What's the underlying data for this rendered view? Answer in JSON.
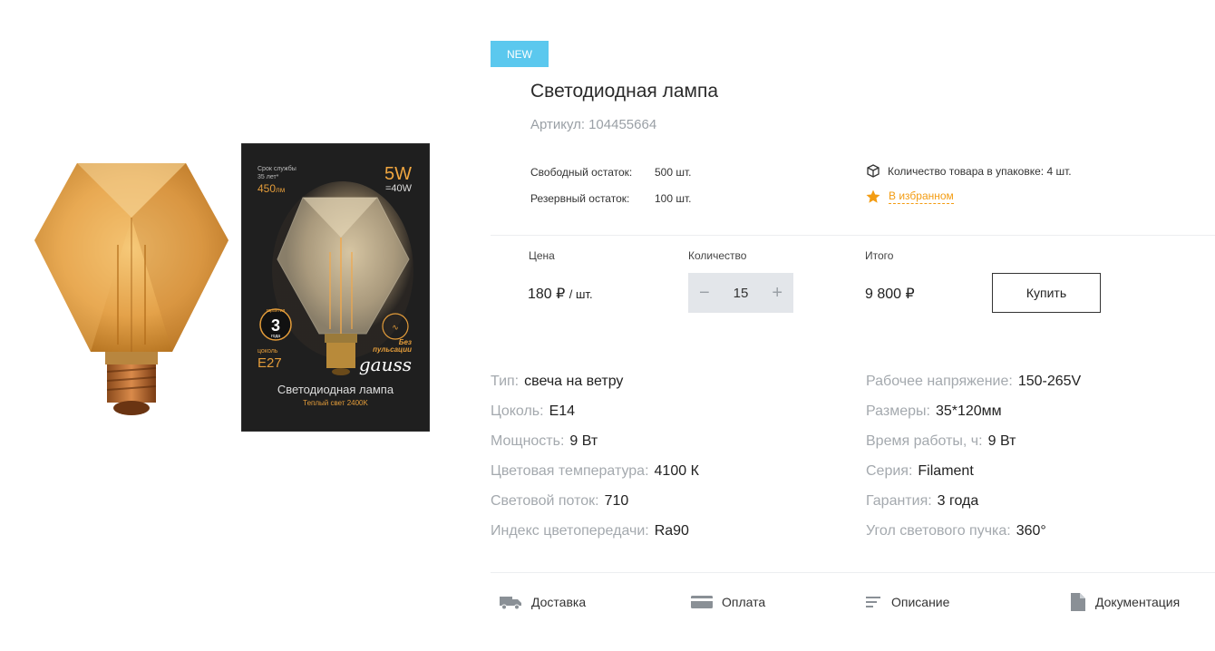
{
  "product": {
    "badge": "NEW",
    "title": "Светодиодная лампа",
    "sku_label": "Артикул:",
    "sku": "104455664",
    "box_print": {
      "lifetime_label": "Срок службы",
      "lifetime_value": "35 лет*",
      "lumen": "450",
      "lumen_unit": "лм",
      "watt": "5W",
      "watt_eq": "=40W",
      "warranty_word": "гарантия",
      "warranty_years": "3",
      "warranty_years_word": "года",
      "base_label": "цоколь",
      "base": "E27",
      "no_flicker_1": "Без",
      "no_flicker_2": "пульсации",
      "brand": "gauss",
      "name": "Светодиодная лампа",
      "light": "Теплый свет 2400K"
    }
  },
  "stock": {
    "free_label": "Свободный остаток:",
    "free_value": "500 шт.",
    "reserve_label": "Резервный остаток:",
    "reserve_value": "100 шт.",
    "pack_text": "Количество товара в упаковке: 4 шт.",
    "pack_icon": "box-icon",
    "favorite_text": "В избранном",
    "favorite_icon": "star-icon"
  },
  "order": {
    "price_caption": "Цена",
    "price_value": "180 ₽",
    "price_unit": "/ шт.",
    "qty_caption": "Количество",
    "qty_value": "15",
    "qty_minus": "−",
    "qty_plus": "+",
    "total_caption": "Итого",
    "total_value": "9 800 ₽",
    "buy_label": "Купить"
  },
  "specs_left": [
    {
      "key": "Тип:",
      "value": "свеча на ветру"
    },
    {
      "key": "Цоколь:",
      "value": "E14"
    },
    {
      "key": "Мощность:",
      "value": "9 Вт"
    },
    {
      "key": "Цветовая температура:",
      "value": "4100 К"
    },
    {
      "key": "Световой поток:",
      "value": "710"
    },
    {
      "key": "Индекс цветопередачи:",
      "value": "Ra90"
    }
  ],
  "specs_right": [
    {
      "key": "Рабочее напряжение:",
      "value": "150-265V"
    },
    {
      "key": "Размеры:",
      "value": "35*120мм"
    },
    {
      "key": "Время работы, ч:",
      "value": "9 Вт"
    },
    {
      "key": "Серия:",
      "value": "Filament"
    },
    {
      "key": "Гарантия:",
      "value": "3 года"
    },
    {
      "key": "Угол светового пучка:",
      "value": "360°"
    }
  ],
  "tabs": [
    {
      "label": "Доставка",
      "icon": "truck-icon"
    },
    {
      "label": "Оплата",
      "icon": "card-icon"
    },
    {
      "label": "Описание",
      "icon": "lines-icon"
    },
    {
      "label": "Документация",
      "icon": "document-icon"
    }
  ],
  "colors": {
    "badge": "#5bc8ee",
    "favorite": "#f39c12",
    "muted_text": "#a4a9ae",
    "qty_bg": "#e3e6ea"
  }
}
